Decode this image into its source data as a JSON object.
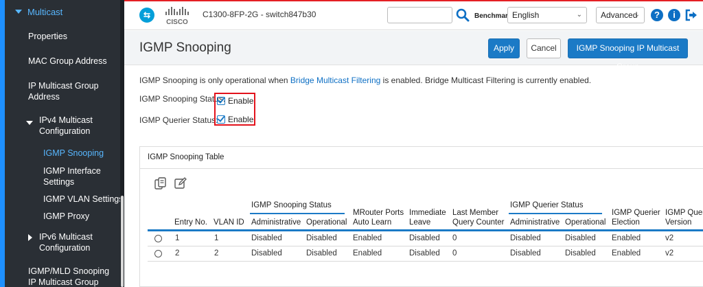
{
  "sidebar": {
    "section": "Multicast",
    "items": [
      {
        "label": "Properties"
      },
      {
        "label": "MAC Group Address"
      },
      {
        "label": "IP Multicast Group Address"
      },
      {
        "label": "IPv4 Multicast Configuration"
      },
      {
        "label": "IGMP Snooping"
      },
      {
        "label": "IGMP Interface Settings"
      },
      {
        "label": "IGMP VLAN Settings"
      },
      {
        "label": "IGMP Proxy"
      },
      {
        "label": "IPv6 Multicast Configuration"
      },
      {
        "label": "IGMP/MLD Snooping IP Multicast Group"
      }
    ]
  },
  "topbar": {
    "brand": "CISCO",
    "device": "C1300-8FP-2G - switch847b30",
    "search_value": "",
    "benchmark_label": "Benchmark",
    "language": "English",
    "mode": "Advanced",
    "help_icon": "question-icon",
    "info_icon": "info-icon",
    "logout_icon": "logout-icon"
  },
  "header": {
    "title": "IGMP Snooping",
    "apply": "Apply",
    "cancel": "Cancel",
    "multicast_group": "IGMP Snooping IP Multicast Group"
  },
  "content": {
    "info_pre": "IGMP Snooping is only operational when ",
    "info_link": "Bridge Multicast Filtering",
    "info_post": " is enabled. Bridge Multicast Filtering is currently enabled.",
    "snooping_status_label": "IGMP Snooping Status:",
    "querier_status_label": "IGMP Querier Status:",
    "enable_label": "Enable",
    "snooping_enabled": true,
    "querier_enabled": true
  },
  "table": {
    "title": "IGMP Snooping Table",
    "group_snooping": "IGMP Snooping Status",
    "group_querier": "IGMP Querier Status",
    "headers": {
      "entry_no": "Entry No.",
      "vlan_id": "VLAN ID",
      "administrative": "Administrative",
      "operational": "Operational",
      "mrouter_1": "MRouter Ports",
      "mrouter_2": "Auto Learn",
      "immediate_1": "Immediate",
      "immediate_2": "Leave",
      "lastmember_1": "Last Member",
      "lastmember_2": "Query Counter",
      "q_admin": "Administrative",
      "q_oper": "Operational",
      "election_1": "IGMP Querier",
      "election_2": "Election",
      "version_1": "IGMP Querier",
      "version_2": "Version"
    },
    "rows": [
      {
        "entry": "1",
        "vlan": "1",
        "admin": "Disabled",
        "oper": "Disabled",
        "mrouter": "Enabled",
        "leave": "Disabled",
        "lmqc": "0",
        "q_admin": "Disabled",
        "q_oper": "Disabled",
        "election": "Enabled",
        "version": "v2"
      },
      {
        "entry": "2",
        "vlan": "2",
        "admin": "Disabled",
        "oper": "Disabled",
        "mrouter": "Enabled",
        "leave": "Disabled",
        "lmqc": "0",
        "q_admin": "Disabled",
        "q_oper": "Disabled",
        "election": "Enabled",
        "version": "v2"
      }
    ]
  },
  "colors": {
    "accent_blue": "#1b7ac6",
    "sidebar_bg": "#2a2f35",
    "highlight_red": "#e2121b",
    "cisco_blue": "#049fd9"
  }
}
